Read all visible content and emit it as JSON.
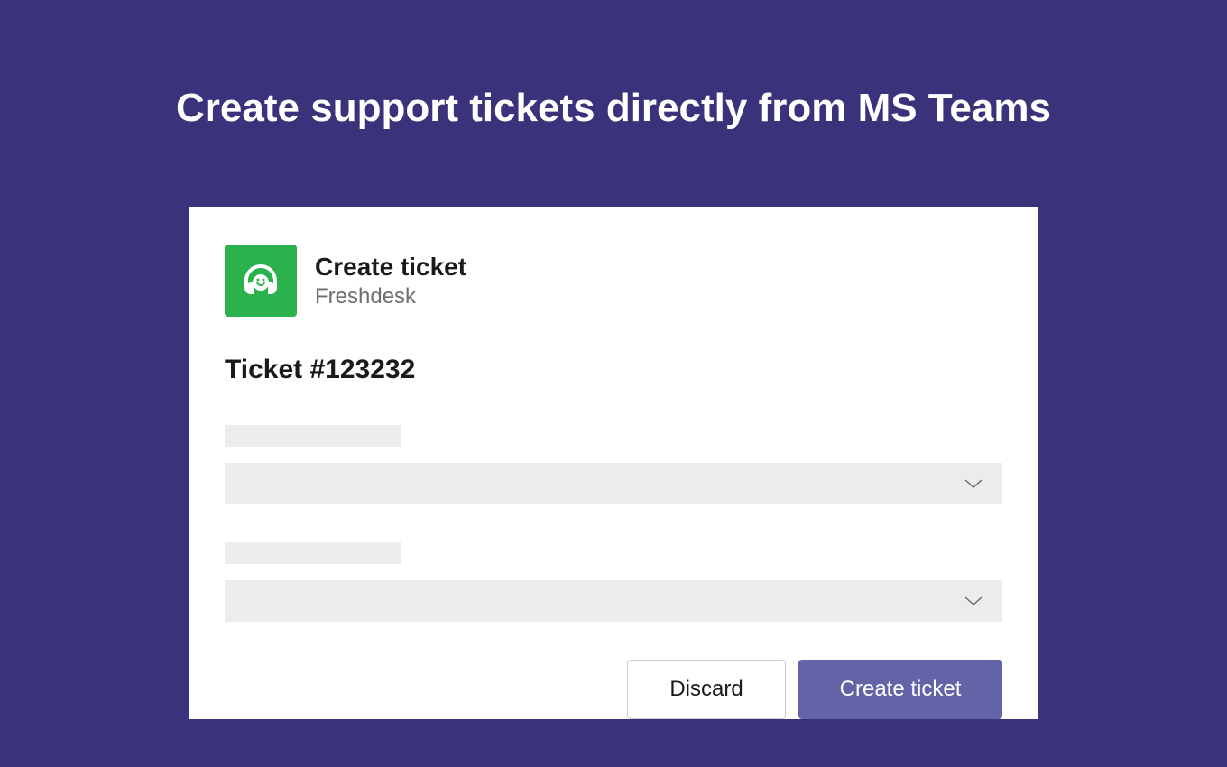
{
  "page": {
    "title": "Create support tickets directly from MS Teams"
  },
  "card": {
    "title": "Create ticket",
    "subtitle": "Freshdesk",
    "ticket_number": "Ticket #123232"
  },
  "buttons": {
    "discard": "Discard",
    "create": "Create ticket"
  },
  "colors": {
    "background": "#3a327a",
    "app_icon": "#2bb24c",
    "primary_button": "#6264a7"
  }
}
